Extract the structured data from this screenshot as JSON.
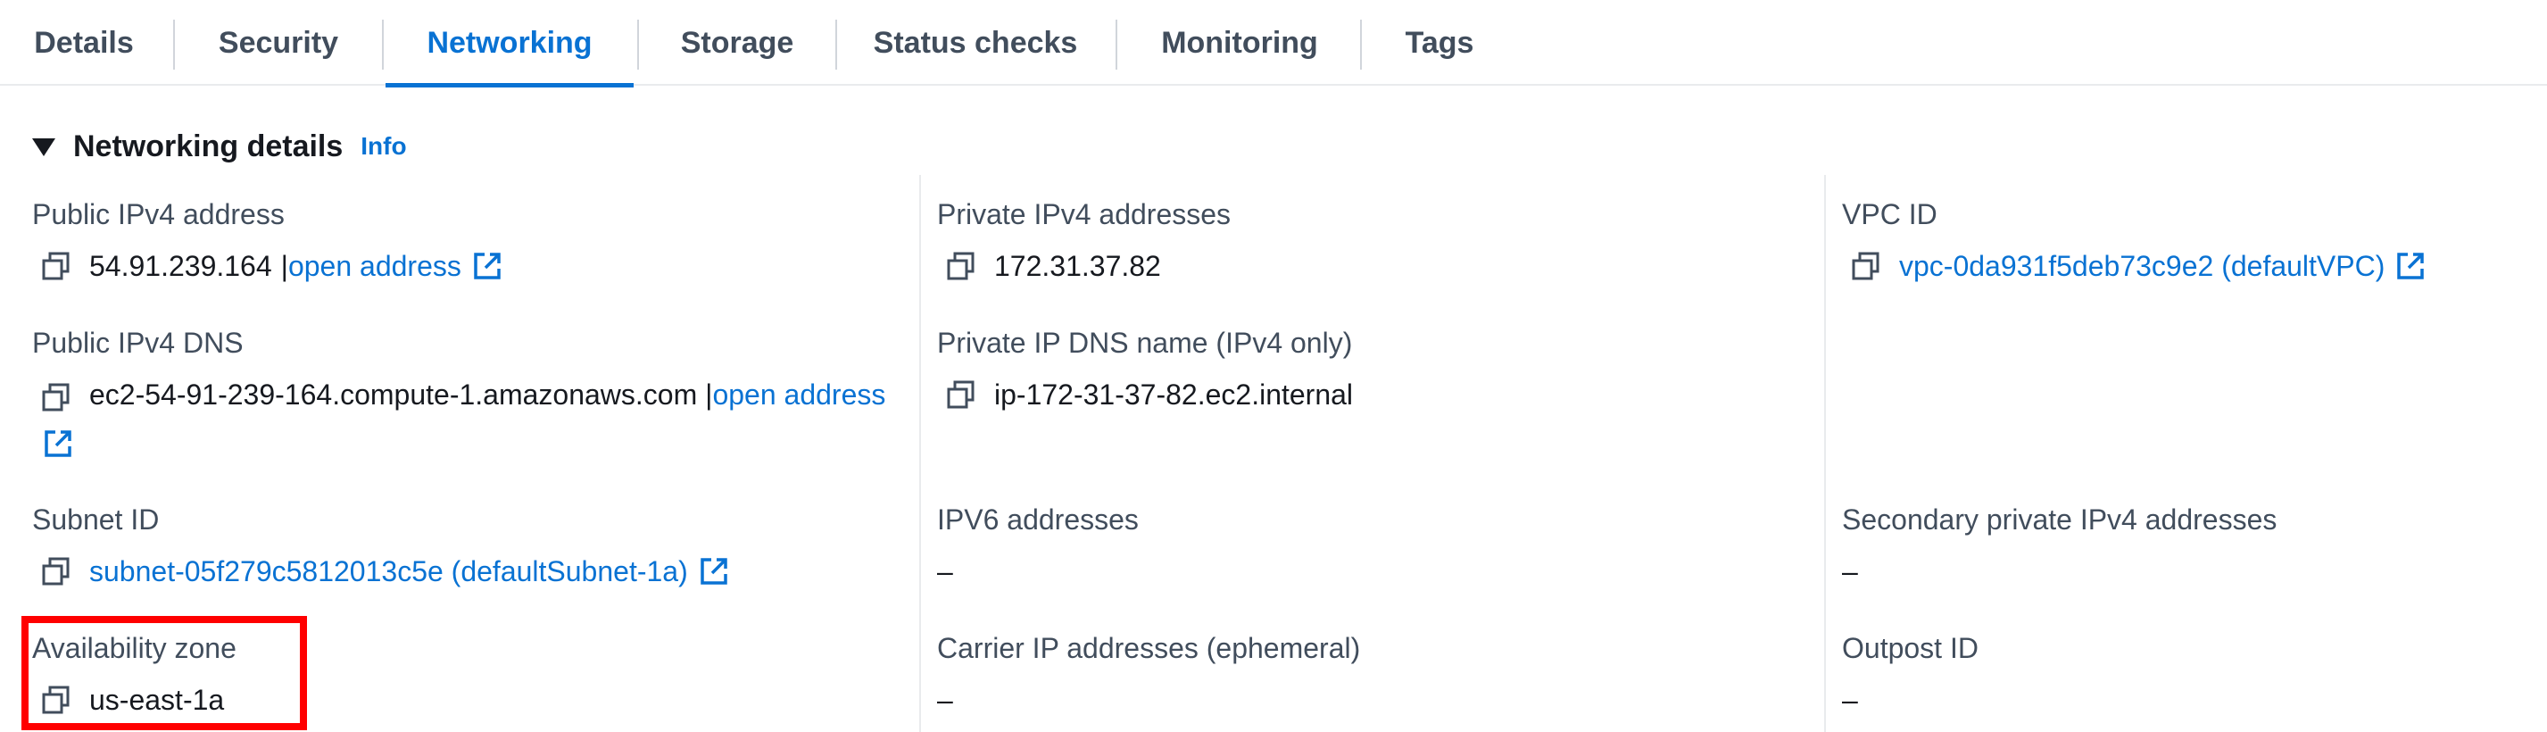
{
  "tabs": [
    {
      "label": "Details",
      "active": false
    },
    {
      "label": "Security",
      "active": false
    },
    {
      "label": "Networking",
      "active": true
    },
    {
      "label": "Storage",
      "active": false
    },
    {
      "label": "Status checks",
      "active": false
    },
    {
      "label": "Monitoring",
      "active": false
    },
    {
      "label": "Tags",
      "active": false
    }
  ],
  "section": {
    "title": "Networking details",
    "info": "Info"
  },
  "fields": {
    "public_ipv4_address": {
      "label": "Public IPv4 address",
      "value": "54.91.239.164",
      "separator": "|",
      "link": "open address"
    },
    "private_ipv4_addresses": {
      "label": "Private IPv4 addresses",
      "value": "172.31.37.82"
    },
    "vpc_id": {
      "label": "VPC ID",
      "value": "vpc-0da931f5deb73c9e2 (defaultVPC)"
    },
    "public_ipv4_dns": {
      "label": "Public IPv4 DNS",
      "value": "ec2-54-91-239-164.compute-1.amazonaws.com",
      "separator": "|",
      "link": "open address"
    },
    "private_ip_dns_name": {
      "label": "Private IP DNS name (IPv4 only)",
      "value": "ip-172-31-37-82.ec2.internal"
    },
    "subnet_id": {
      "label": "Subnet ID",
      "value": "subnet-05f279c5812013c5e (defaultSubnet-1a)"
    },
    "ipv6_addresses": {
      "label": "IPV6 addresses",
      "value": "–"
    },
    "secondary_private_ipv4": {
      "label": "Secondary private IPv4 addresses",
      "value": "–"
    },
    "availability_zone": {
      "label": "Availability zone",
      "value": "us-east-1a"
    },
    "carrier_ip_addresses": {
      "label": "Carrier IP addresses (ephemeral)",
      "value": "–"
    },
    "outpost_id": {
      "label": "Outpost ID",
      "value": "–"
    }
  },
  "icons": {
    "copy": "copy-icon",
    "external": "external-link-icon",
    "caret": "caret-down-icon"
  },
  "colors": {
    "link": "#0972d3",
    "text": "#16191f",
    "label": "#414d5c",
    "highlight": "#ff0000"
  }
}
